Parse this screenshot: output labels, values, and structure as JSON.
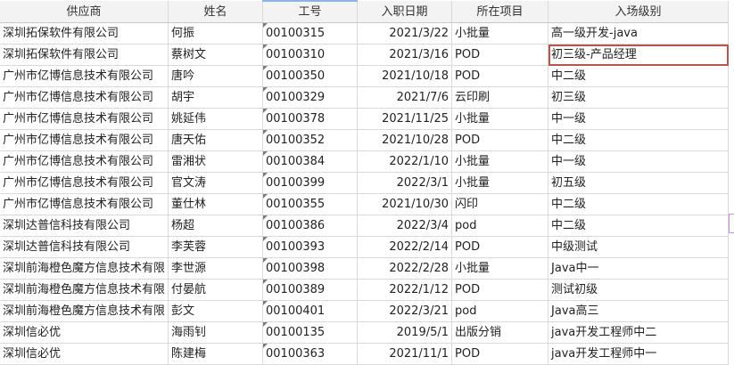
{
  "headers": [
    "供应商",
    "姓名",
    "工号",
    "入职日期",
    "所在项目",
    "入场级别"
  ],
  "rows": [
    [
      "深圳拓保软件有限公司",
      "何振",
      "00100315",
      "2021/3/22",
      "小批量",
      "高一级开发-java"
    ],
    [
      "深圳拓保软件有限公司",
      "蔡树文",
      "00100310",
      "2021/3/16",
      "POD",
      "初三级-产品经理"
    ],
    [
      "广州市亿博信息技术有限公司",
      "唐吟",
      "00100350",
      "2021/10/18",
      "POD",
      "中二级"
    ],
    [
      "广州市亿博信息技术有限公司",
      "胡宇",
      "00100329",
      "2021/7/6",
      "云印刷",
      "初三级"
    ],
    [
      "广州市亿博信息技术有限公司",
      "姚延伟",
      "00100378",
      "2021/11/25",
      "小批量",
      "中一级"
    ],
    [
      "广州市亿博信息技术有限公司",
      "唐天佑",
      "00100352",
      "2021/10/28",
      "POD",
      "中二级"
    ],
    [
      "广州市亿博信息技术有限公司",
      "雷湘状",
      "00100384",
      "2022/1/10",
      "小批量",
      "中一级"
    ],
    [
      "广州市亿博信息技术有限公司",
      "官文涛",
      "00100399",
      "2022/3/1",
      "小批量",
      "初五级"
    ],
    [
      "广州市亿博信息技术有限公司",
      "董仕林",
      "00100355",
      "2021/10/30",
      "闪印",
      "中二级"
    ],
    [
      "深圳达普信科技有限公司",
      "杨超",
      "00100386",
      "2022/3/4",
      "pod",
      "中二级"
    ],
    [
      "深圳达普信科技有限公司",
      "李芙蓉",
      "00100393",
      "2022/2/14",
      "POD",
      "中级测试"
    ],
    [
      "深圳前海橙色魔方信息技术有限",
      "李世源",
      "00100398",
      "2022/2/28",
      "小批量",
      "Java中一"
    ],
    [
      "深圳前海橙色魔方信息技术有限",
      "付晏航",
      "00100389",
      "2022/1/12",
      "POD",
      "测试初级"
    ],
    [
      "深圳前海橙色魔方信息技术有限",
      "彭文",
      "00100401",
      "2022/3/21",
      "pod",
      "Java高三"
    ],
    [
      "深圳信必优",
      "海雨钊",
      "00100135",
      "2019/5/1",
      "出版分销",
      "java开发工程师中二"
    ],
    [
      "深圳信必优",
      "陈建梅",
      "00100363",
      "2021/11/1",
      "POD",
      "java开发工程师中一"
    ]
  ]
}
